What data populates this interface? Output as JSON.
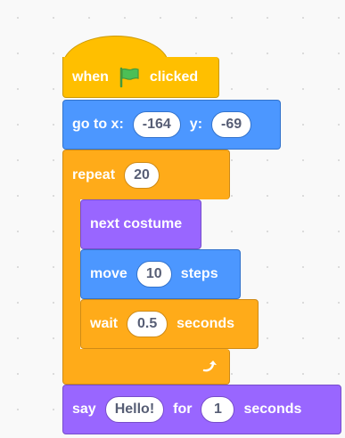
{
  "hat": {
    "when": "when",
    "flag_icon": "green-flag-icon",
    "clicked": "clicked"
  },
  "goto": {
    "label": "go to x:",
    "x_value": "-164",
    "y_label": "y:",
    "y_value": "-69"
  },
  "repeat": {
    "label": "repeat",
    "count": "20",
    "loop_icon": "loop-arrow-icon"
  },
  "next_costume": {
    "label": "next costume"
  },
  "move": {
    "label": "move",
    "steps_value": "10",
    "steps_label": "steps"
  },
  "wait": {
    "label": "wait",
    "value": "0.5",
    "seconds_label": "seconds"
  },
  "say": {
    "label": "say",
    "message": "Hello!",
    "for_label": "for",
    "seconds_value": "1",
    "seconds_label": "seconds"
  },
  "colors": {
    "events": "#ffbf00",
    "motion": "#4c97ff",
    "control": "#ffab19",
    "looks": "#9966ff",
    "canvas": "#f9f9f9",
    "text_dark": "#575e75"
  }
}
